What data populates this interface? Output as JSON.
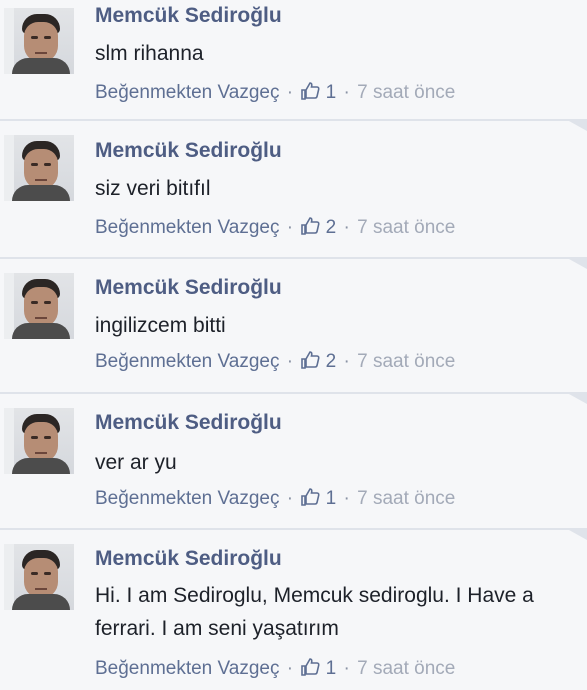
{
  "comments": [
    {
      "author": "Memcük Sediroğlu",
      "text": "slm rihanna",
      "unlike_label": "Beğenmekten Vazgeç",
      "like_count": "1",
      "time": "7 saat önce"
    },
    {
      "author": "Memcük Sediroğlu",
      "text": "siz veri bitıfıl",
      "unlike_label": "Beğenmekten Vazgeç",
      "like_count": "2",
      "time": "7 saat önce"
    },
    {
      "author": "Memcük Sediroğlu",
      "text": "ingilizcem bitti",
      "unlike_label": "Beğenmekten Vazgeç",
      "like_count": "2",
      "time": "7 saat önce"
    },
    {
      "author": "Memcük Sediroğlu",
      "text": "ver ar yu",
      "unlike_label": "Beğenmekten Vazgeç",
      "like_count": "1",
      "time": "7 saat önce"
    },
    {
      "author": "Memcük Sediroğlu",
      "text": "Hi. I am Sediroglu, Memcuk sediroglu. I Have a ferrari. I am seni yaşatırım",
      "unlike_label": "Beğenmekten Vazgeç",
      "like_count": "1",
      "time": "7 saat önce"
    }
  ],
  "icons": {
    "avatar": "profile-photo",
    "like": "thumbs-up-icon",
    "corner": "corner-fold-icon"
  },
  "colors": {
    "name": "#4e5d83",
    "link": "#5e6f93",
    "text": "#1d2129",
    "muted": "#a3aab8",
    "background": "#f6f7f9"
  },
  "separator": "·"
}
